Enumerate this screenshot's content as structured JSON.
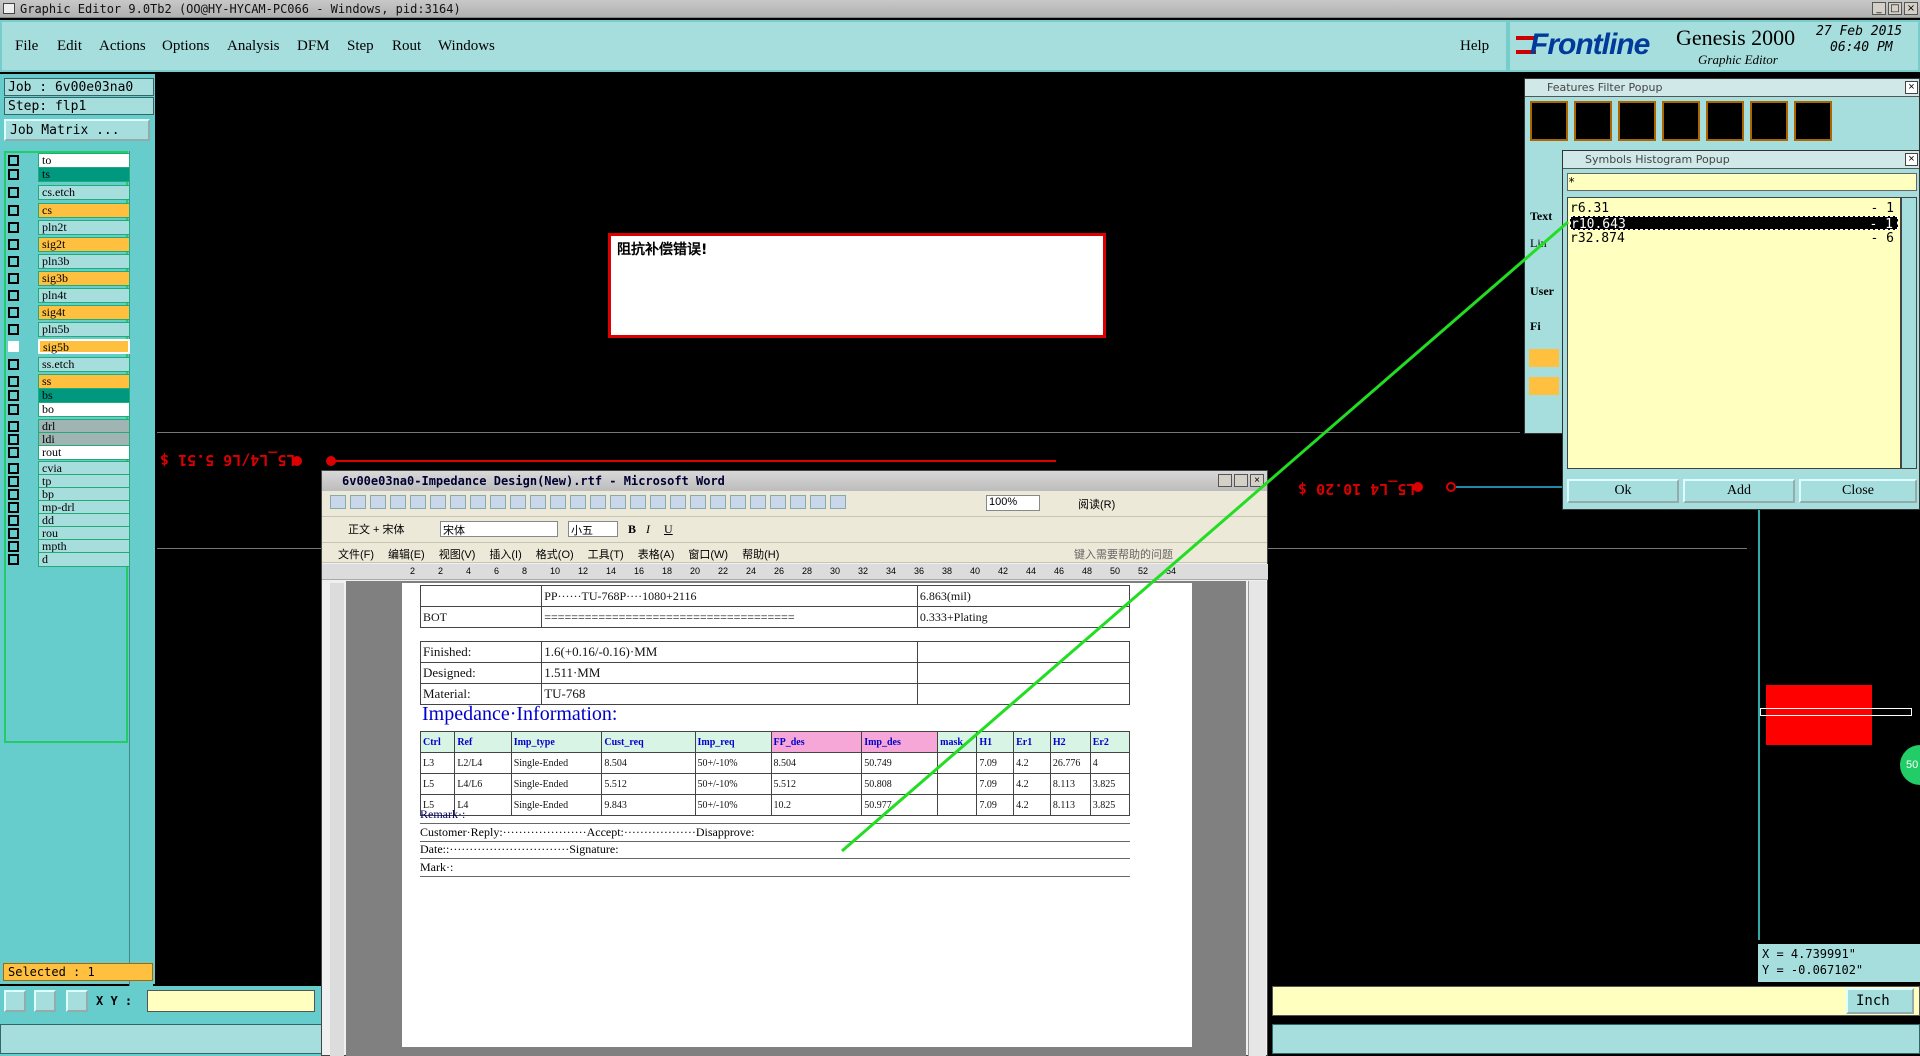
{
  "window": {
    "title": "Graphic Editor 9.0Tb2 (OO@HY-HYCAM-PC066 - Windows, pid:3164)"
  },
  "menu": {
    "items": [
      "File",
      "Edit",
      "Actions",
      "Options",
      "Analysis",
      "DFM",
      "Step",
      "Rout",
      "Windows"
    ],
    "help": "Help"
  },
  "logo": {
    "brand": "Frontline",
    "product": "Genesis 2000",
    "subtitle": "Graphic Editor",
    "date": "27 Feb 2015",
    "time": "06:40 PM"
  },
  "job": {
    "job": "Job : 6v00e03na0",
    "step": "Step: flp1",
    "matrix_btn": "Job Matrix ..."
  },
  "layers1": [
    {
      "name": "to",
      "color": "#ffffff"
    },
    {
      "name": "ts",
      "color": "#009980"
    },
    {
      "name": "cs.etch",
      "color": "#a6dede"
    },
    {
      "name": "cs",
      "color": "#ffc040"
    },
    {
      "name": "pln2t",
      "color": "#a6dede"
    },
    {
      "name": "sig2t",
      "color": "#ffc040"
    },
    {
      "name": "pln3b",
      "color": "#a6dede"
    },
    {
      "name": "sig3b",
      "color": "#ffc040"
    },
    {
      "name": "pln4t",
      "color": "#a6dede"
    },
    {
      "name": "sig4t",
      "color": "#ffc040"
    },
    {
      "name": "pln5b",
      "color": "#a6dede"
    },
    {
      "name": "sig5b",
      "color": "#ffc040"
    },
    {
      "name": "ss.etch",
      "color": "#a6dede"
    },
    {
      "name": "ss",
      "color": "#ffc040"
    },
    {
      "name": "bs",
      "color": "#009980"
    },
    {
      "name": "bo",
      "color": "#ffffff"
    }
  ],
  "layers2": [
    {
      "name": "drl",
      "color": "#a0b4b4"
    },
    {
      "name": "ldi",
      "color": "#a0b4b4"
    },
    {
      "name": "rout",
      "color": "#ffffff"
    }
  ],
  "layers3": [
    {
      "name": "cvia"
    },
    {
      "name": "tp"
    },
    {
      "name": "bp"
    },
    {
      "name": "mp-drl"
    },
    {
      "name": "dd"
    },
    {
      "name": "rou"
    },
    {
      "name": "mpth"
    },
    {
      "name": "d"
    }
  ],
  "status": {
    "selected": "Selected : 1",
    "xy_label": "X Y :",
    "xy_value": "",
    "x": "X = 4.739991\"",
    "y": "Y = -0.067102\"",
    "units": "Inch"
  },
  "canvas": {
    "error_msg": "阻抗补偿错误!",
    "label_left": "L5_L4/L6 5.51 $",
    "label_right": "L5_L4 10.20 $",
    "pad_label": "50"
  },
  "filter_popup": {
    "title": "Features Filter Popup",
    "text_lbl": "Text",
    "lin": "Lin",
    "user": "User",
    "fi": "Fi"
  },
  "histogram": {
    "title": "Symbols Histogram Popup",
    "filter": "*",
    "items": [
      {
        "sym": "r6.31",
        "count": "- 1"
      },
      {
        "sym": "r10.643",
        "count": "- 1"
      },
      {
        "sym": "r32.874",
        "count": "- 6"
      }
    ],
    "ok": "Ok",
    "add": "Add",
    "close": "Close"
  },
  "word": {
    "title": "6v00e03na0-Impedance Design(New).rtf - Microsoft Word",
    "zoom": "100%",
    "read": "阅读(R)",
    "style": "正文 + 宋体",
    "font": "宋体",
    "size": "小五",
    "menus": [
      "文件(F)",
      "编辑(E)",
      "视图(V)",
      "插入(I)",
      "格式(O)",
      "工具(T)",
      "表格(A)",
      "窗口(W)",
      "帮助(H)"
    ],
    "help_prompt": "键入需要帮助的问题",
    "ruler": [
      "2",
      "2",
      "4",
      "6",
      "8",
      "10",
      "12",
      "14",
      "16",
      "18",
      "20",
      "22",
      "24",
      "26",
      "28",
      "30",
      "32",
      "34",
      "36",
      "38",
      "40",
      "42",
      "44",
      "46",
      "48",
      "50",
      "52",
      "54"
    ],
    "stack": [
      [
        "",
        "PP······TU-768P····1080+2116",
        "6.863(mil)"
      ],
      [
        "BOT",
        "=====================================",
        "0.333+Plating"
      ]
    ],
    "spec": [
      [
        "Finished:",
        "1.6(+0.16/-0.16)·MM",
        ""
      ],
      [
        "Designed:",
        "1.511·MM",
        ""
      ],
      [
        "Material:",
        "TU-768",
        ""
      ]
    ],
    "imp_title": "Impedance·Information:",
    "imp_headers": [
      "Ctrl",
      "Ref",
      "Imp_type",
      "Cust_req",
      "Imp_req",
      "FP_des",
      "Imp_des",
      "mask",
      "H1",
      "Er1",
      "H2",
      "Er2"
    ],
    "imp_rows": [
      [
        "L3",
        "L2/L4",
        "Single-Ended",
        "8.504",
        "50+/-10%",
        "8.504",
        "50.749",
        "",
        "7.09",
        "4.2",
        "26.776",
        "4"
      ],
      [
        "L5",
        "L4/L6",
        "Single-Ended",
        "5.512",
        "50+/-10%",
        "5.512",
        "50.808",
        "",
        "7.09",
        "4.2",
        "8.113",
        "3.825"
      ],
      [
        "L5",
        "L4",
        "Single-Ended",
        "9.843",
        "50+/-10%",
        "10.2",
        "50.977",
        "",
        "7.09",
        "4.2",
        "8.113",
        "3.825"
      ]
    ],
    "remark": "Remark·:",
    "reply": "Customer·Reply:·····················Accept:··················Disapprove:",
    "date": "Date::······························Signature:",
    "mark": "Mark·:"
  }
}
